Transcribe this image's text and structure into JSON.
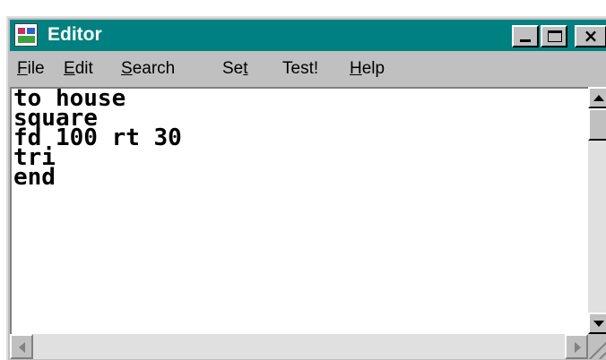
{
  "window": {
    "title": "Editor",
    "title_bar_color": "#008080",
    "face_color": "#c0c0c0",
    "icons": {
      "app": "editor-app-icon",
      "minimize": "minimize-icon",
      "maximize": "maximize-icon",
      "close": "close-icon"
    },
    "close_glyph": "×"
  },
  "menu": {
    "items": [
      {
        "mnemonic": "F",
        "rest": "ile"
      },
      {
        "mnemonic": "E",
        "rest": "dit"
      },
      {
        "mnemonic": "S",
        "rest": "earch"
      },
      {
        "pre": "Se",
        "mnemonic": "t",
        "rest": ""
      },
      {
        "pre": "Test!",
        "mnemonic": "",
        "rest": ""
      },
      {
        "mnemonic": "H",
        "rest": "elp"
      }
    ]
  },
  "editor": {
    "lines": [
      "to house",
      "square",
      "fd 100 rt 30",
      "tri",
      "end"
    ]
  },
  "scrollbars": {
    "vertical_thumb_fraction": 0.0
  }
}
